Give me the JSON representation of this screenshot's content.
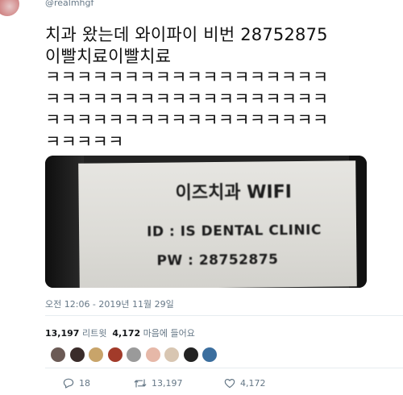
{
  "author": {
    "handle": "@realmhgf"
  },
  "tweet": {
    "text": "치과 왔는데 와이파이 비번 28752875\n이빨치료이빨치료\nㅋㅋㅋㅋㅋㅋㅋㅋㅋㅋㅋㅋㅋㅋㅋㅋㅋㅋ\nㅋㅋㅋㅋㅋㅋㅋㅋㅋㅋㅋㅋㅋㅋㅋㅋㅋㅋ\nㅋㅋㅋㅋㅋㅋㅋㅋㅋㅋㅋㅋㅋㅋㅋㅋㅋㅋ\nㅋㅋㅋㅋㅋ",
    "photo": {
      "title": "이즈치과 WIFI",
      "id_line": "ID : IS DENTAL CLINIC",
      "pw_line": "PW : 28752875"
    },
    "timestamp": "오전 12:06 - 2019년 11월 29일"
  },
  "stats": {
    "retweets_count": "13,197",
    "retweets_label": "리트윗",
    "likes_count": "4,172",
    "likes_label": "마음에 들어요"
  },
  "likers": [
    "#6b5a55",
    "#3a2c2a",
    "#c8a46a",
    "#a23b2a",
    "#9a9a9a",
    "#e6b8a8",
    "#d8c6b2",
    "#222222",
    "#3b6e9e"
  ],
  "actions": {
    "reply_count": "18",
    "retweet_count": "13,197",
    "like_count": "4,172"
  }
}
